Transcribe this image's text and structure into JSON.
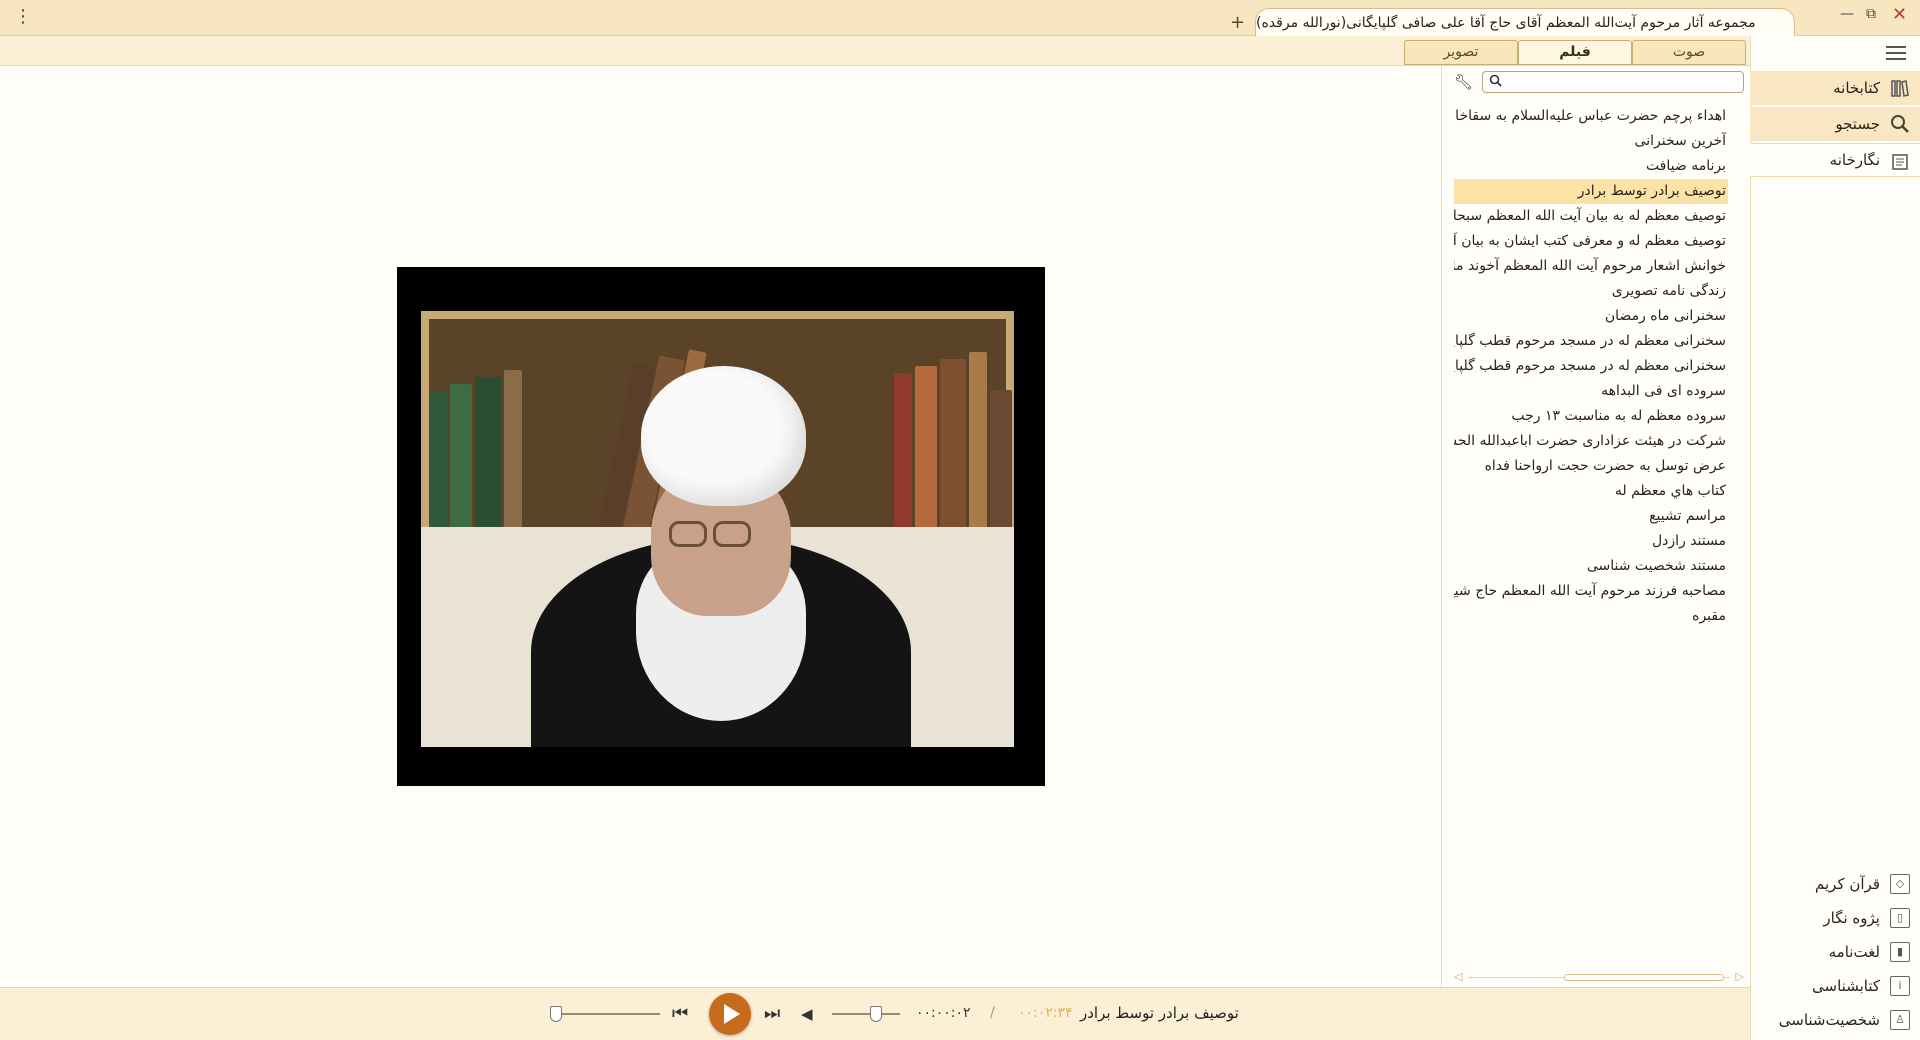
{
  "window": {
    "title": "مجموعه آثار مرحوم آیت‌الله المعظم آقای حاج آقا علی صافی گلپایگانی(نورالله مرقده)",
    "add_tab": "+",
    "menu_glyph": "⋮",
    "minimize_glyph": "—",
    "restore_glyph": "⧉",
    "close_glyph": "✕"
  },
  "media_tabs": [
    {
      "label": "صوت",
      "active": false
    },
    {
      "label": "فیلم",
      "active": true
    },
    {
      "label": "تصویر",
      "active": false
    }
  ],
  "sidebar": {
    "top_items": [
      {
        "label": "کتابخانه",
        "icon": "books-icon"
      },
      {
        "label": "جستجو",
        "icon": "search-icon"
      },
      {
        "label": "نگارخانه",
        "icon": "gallery-icon"
      }
    ],
    "bottom_items": [
      {
        "label": "قرآن کریم",
        "icon": "quran-icon"
      },
      {
        "label": "پژوه نگار",
        "icon": "notebook-icon"
      },
      {
        "label": "لغت‌نامه",
        "icon": "dictionary-icon"
      },
      {
        "label": "کتابشناسی",
        "icon": "info-icon"
      },
      {
        "label": "شخصیت‌شناسی",
        "icon": "person-icon"
      }
    ]
  },
  "search": {
    "placeholder": "",
    "value": ""
  },
  "video_list": [
    "اهداء پرچم حضرت عباس علیه‌السلام به سقاخانه",
    "آخرین سخنرانی",
    "برنامه ضیافت",
    "توصیف برادر توسط برادر",
    "توصیف معظم له به بیان آیت الله المعظم سبحانی",
    "توصیف معظم له و معرفی کتب ایشان به بیان آیت",
    "خوانش اشعار مرحوم آیت الله المعظم آخوند ملا",
    "زندگی نامه تصویری",
    "سخنرانی ماه رمضان",
    "سخنرانی معظم له در مسجد مرحوم قطب گلپایگانی",
    "سخنرانی معظم له در مسجد مرحوم قطب گلپایگانی",
    "سروده ای فی البداهه",
    "سروده معظم له به مناسبت ۱۳ رجب",
    "شرکت در هیئت عزاداری حضرت اباعبدالله الحسین",
    "عرض توسل به حضرت حجت ارواحنا فداه",
    "كتاب هاي معظم له",
    "مراسم تشییع",
    "مستند رازدل",
    "مستند شخصیت شناسی",
    "مصاحبه فرزند مرحوم آیت الله المعظم حاج شیخ",
    "مقبره"
  ],
  "active_index": 3,
  "player": {
    "now_playing": "توصیف برادر توسط برادر",
    "total_time": "۰۰:۰۲:۳۴",
    "separator": "/",
    "current_time": "۰۰:۰۰:۰۲",
    "volume_level": 0.65,
    "progress": 0.0
  },
  "colors": {
    "accent": "#c66a1c",
    "titlebar": "#f7e6c0",
    "highlight": "#fbe3a8"
  }
}
